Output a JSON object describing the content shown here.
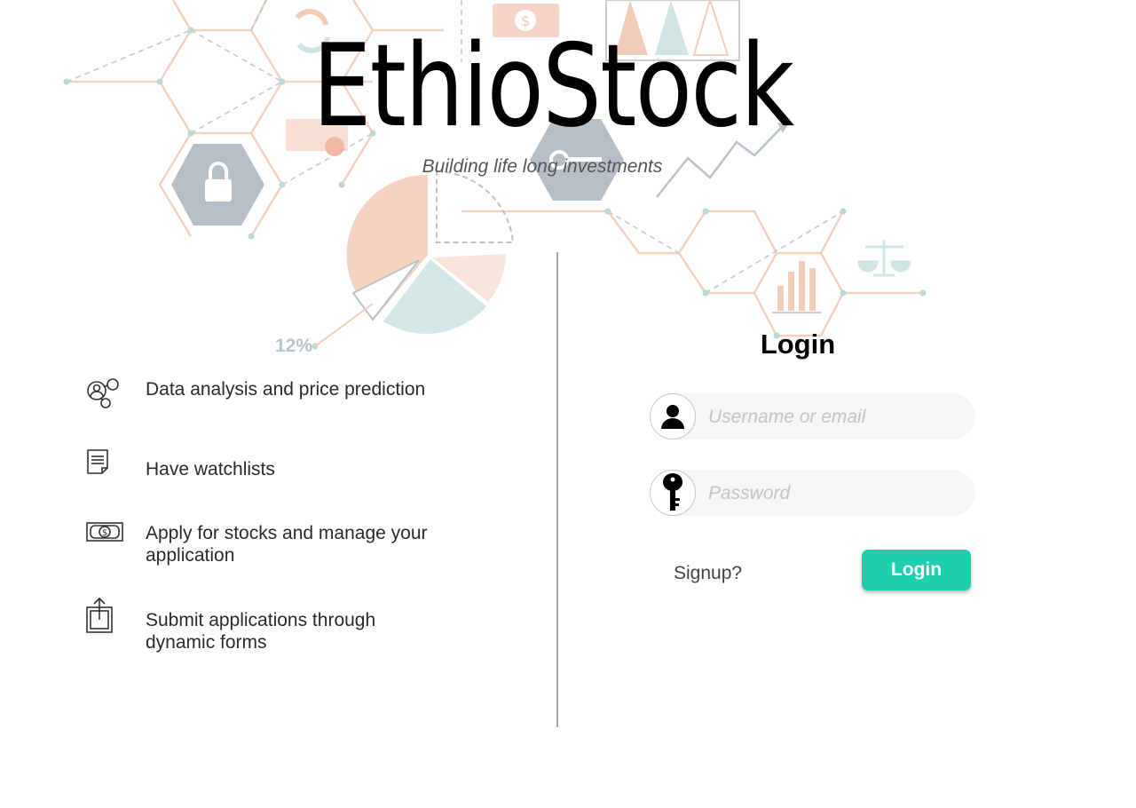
{
  "brand": {
    "title": "EthioStock",
    "tagline": "Building life long investments"
  },
  "features": [
    {
      "icon": "data-analysis-icon",
      "text": "Data analysis and price prediction"
    },
    {
      "icon": "document-icon",
      "text": "Have watchlists"
    },
    {
      "icon": "money-bill-icon",
      "text": "Apply for stocks and manage your application"
    },
    {
      "icon": "upload-icon",
      "text": "Submit applications through dynamic forms"
    }
  ],
  "login": {
    "title": "Login",
    "username_placeholder": "Username or email",
    "password_placeholder": "Password",
    "signup_label": "Signup?",
    "submit_label": "Login"
  },
  "background": {
    "percent_label": "12%"
  },
  "colors": {
    "accent": "#1ecfae",
    "divider": "#a8a8a8",
    "bg_peach": "#f3cbb9",
    "bg_mint": "#cfe6e4",
    "bg_slate": "#a9b4bd"
  }
}
